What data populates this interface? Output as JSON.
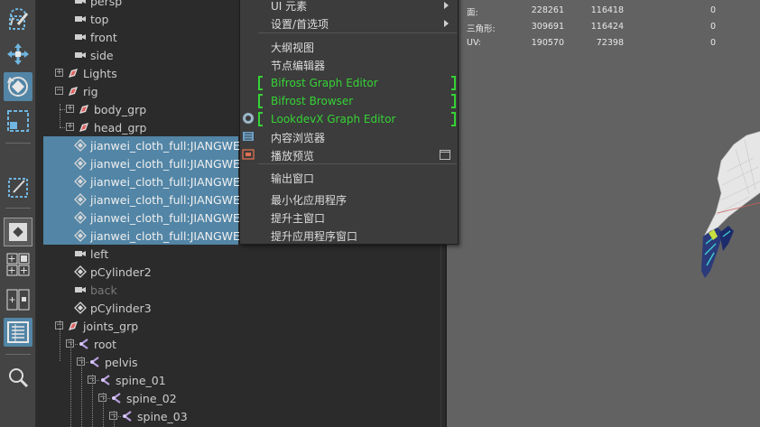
{
  "toolstrip": {
    "tools": [
      "lasso-tool",
      "paint-select-tool",
      "move-tool",
      "rotate-tool",
      "scale-tool",
      "soft-mod-tool",
      "layout-single",
      "layout-four",
      "layout-two",
      "outliner-layout",
      "search-tool"
    ]
  },
  "outliner": {
    "rows": [
      {
        "label": "persp",
        "icon": "camera-icon",
        "kind": "camera"
      },
      {
        "label": "top",
        "icon": "camera-icon",
        "kind": "camera"
      },
      {
        "label": "front",
        "icon": "camera-icon",
        "kind": "camera"
      },
      {
        "label": "side",
        "icon": "camera-icon",
        "kind": "camera"
      },
      {
        "label": "Lights",
        "icon": "group-icon",
        "kind": "group"
      },
      {
        "label": "rig",
        "icon": "group-icon",
        "kind": "group"
      },
      {
        "label": "body_grp",
        "icon": "group-icon",
        "kind": "group"
      },
      {
        "label": "head_grp",
        "icon": "group-icon",
        "kind": "group"
      },
      {
        "label": "jianwei_cloth_full:JIANGWEI_",
        "icon": "mesh-icon",
        "kind": "mesh",
        "selected": true
      },
      {
        "label": "jianwei_cloth_full:JIANGWEI_",
        "icon": "mesh-icon",
        "kind": "mesh",
        "selected": true
      },
      {
        "label": "jianwei_cloth_full:JIANGWEI_",
        "icon": "mesh-icon",
        "kind": "mesh",
        "selected": true
      },
      {
        "label": "jianwei_cloth_full:JIANGWEI_",
        "icon": "mesh-icon",
        "kind": "mesh",
        "selected": true
      },
      {
        "label": "jianwei_cloth_full:JIANGWEI_",
        "icon": "mesh-icon",
        "kind": "mesh",
        "selected": true
      },
      {
        "label": "jianwei_cloth_full:JIANGWEI_",
        "icon": "mesh-icon",
        "kind": "mesh",
        "selected": true
      },
      {
        "label": "left",
        "icon": "camera-icon",
        "kind": "camera"
      },
      {
        "label": "pCylinder2",
        "icon": "mesh-icon",
        "kind": "mesh"
      },
      {
        "label": "back",
        "icon": "camera-icon",
        "kind": "camera",
        "dim": true
      },
      {
        "label": "pCylinder3",
        "icon": "mesh-icon",
        "kind": "mesh"
      },
      {
        "label": "joints_grp",
        "icon": "group-icon",
        "kind": "group"
      },
      {
        "label": "root",
        "icon": "joint-icon",
        "kind": "joint"
      },
      {
        "label": "pelvis",
        "icon": "joint-icon",
        "kind": "joint"
      },
      {
        "label": "spine_01",
        "icon": "joint-icon",
        "kind": "joint"
      },
      {
        "label": "spine_02",
        "icon": "joint-icon",
        "kind": "joint"
      },
      {
        "label": "spine_03",
        "icon": "joint-icon",
        "kind": "joint"
      }
    ]
  },
  "menu": {
    "items": [
      {
        "label": "UI 元素",
        "submenu": true
      },
      {
        "label": "设置/首选项",
        "submenu": true
      },
      {
        "label": "大纲视图"
      },
      {
        "label": "节点编辑器"
      },
      {
        "label": "Bifrost Graph Editor",
        "green": true
      },
      {
        "label": "Bifrost Browser",
        "green": true
      },
      {
        "label": "LookdevX Graph Editor",
        "green": true
      },
      {
        "label": "内容浏览器"
      },
      {
        "label": "播放预览",
        "box": true
      },
      {
        "label": "输出窗口"
      },
      {
        "label": "最小化应用程序"
      },
      {
        "label": "提升主窗口"
      },
      {
        "label": "提升应用程序窗口"
      }
    ]
  },
  "hud": {
    "rows": [
      {
        "label": "面:",
        "a": "228261",
        "b": "116418",
        "c": "0"
      },
      {
        "label": "三角形:",
        "a": "309691",
        "b": "116424",
        "c": "0"
      },
      {
        "label": "UV:",
        "a": "190570",
        "b": "72398",
        "c": "0"
      }
    ]
  },
  "colors": {
    "selection": "#5285a6",
    "bifrost_green": "#35d335",
    "outliner_bg": "#2b2b2b",
    "viewport_bg": "#626262"
  }
}
